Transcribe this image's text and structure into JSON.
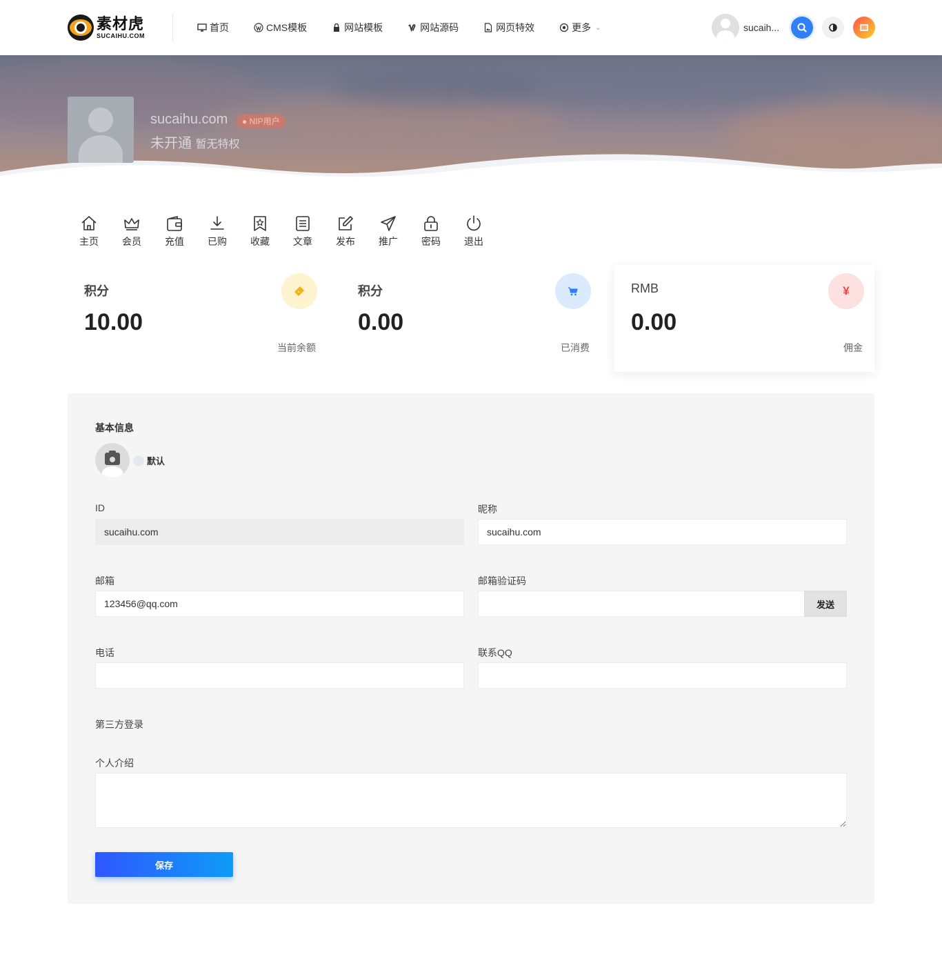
{
  "header": {
    "logo_cn": "素材虎",
    "logo_en": "SUCAIHU.COM",
    "nav": [
      {
        "label": "首页",
        "icon": "monitor-icon"
      },
      {
        "label": "CMS模板",
        "icon": "wordpress-icon"
      },
      {
        "label": "网站模板",
        "icon": "lock-icon"
      },
      {
        "label": "网站源码",
        "icon": "vimeo-icon"
      },
      {
        "label": "网页特效",
        "icon": "file-image-icon"
      },
      {
        "label": "更多",
        "icon": "target-icon"
      }
    ],
    "user_name": "sucaihu.com",
    "user_name_display": "sucaih...",
    "colors": {
      "search": "#2f80f6",
      "menu_gradient": [
        "#ff4e50",
        "#f9d423"
      ]
    }
  },
  "profile": {
    "name": "sucaihu.com",
    "badge": "NIP用户",
    "status": "未开通",
    "status_note": "暂无特权"
  },
  "menu": [
    {
      "label": "主页",
      "icon": "home-icon"
    },
    {
      "label": "会员",
      "icon": "crown-icon"
    },
    {
      "label": "充值",
      "icon": "wallet-icon"
    },
    {
      "label": "已购",
      "icon": "download-icon"
    },
    {
      "label": "收藏",
      "icon": "bookmark-star-icon"
    },
    {
      "label": "文章",
      "icon": "article-icon"
    },
    {
      "label": "发布",
      "icon": "edit-icon"
    },
    {
      "label": "推广",
      "icon": "send-icon"
    },
    {
      "label": "密码",
      "icon": "lock-icon"
    },
    {
      "label": "退出",
      "icon": "power-icon"
    }
  ],
  "stats": [
    {
      "label": "积分",
      "value": "10.00",
      "foot": "当前余额",
      "icon": "ticket-icon",
      "icon_bg": "#fdf3cf",
      "icon_color": "#f5b014"
    },
    {
      "label": "积分",
      "value": "0.00",
      "foot": "已消费",
      "icon": "cart-icon",
      "icon_bg": "#dbeafc",
      "icon_color": "#2f80f6"
    },
    {
      "label": "RMB",
      "value": "0.00",
      "foot": "佣金",
      "icon": "yen-icon",
      "icon_bg": "#fde0e0",
      "icon_color": "#f0464a"
    }
  ],
  "form": {
    "section_title": "基本信息",
    "avatar_option": "默认",
    "id_label": "ID",
    "id_value": "sucaihu.com",
    "nickname_label": "昵称",
    "nickname_value": "sucaihu.com",
    "email_label": "邮箱",
    "email_value": "123456@qq.com",
    "email_code_label": "邮箱验证码",
    "email_code_value": "",
    "send_label": "发送",
    "phone_label": "电话",
    "phone_value": "",
    "qq_label": "联系QQ",
    "qq_value": "",
    "third_party_label": "第三方登录",
    "bio_label": "个人介绍",
    "bio_value": "",
    "save_label": "保存"
  }
}
